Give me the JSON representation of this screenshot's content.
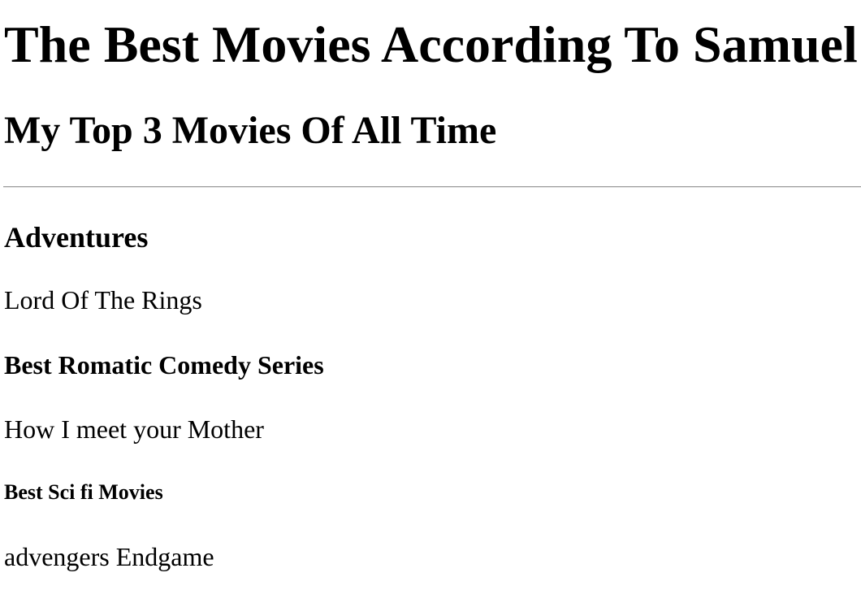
{
  "page": {
    "main_heading": "The Best Movies According To Samuel",
    "sub_heading": "My Top 3 Movies Of All Time"
  },
  "sections": [
    {
      "heading": "Adventures",
      "movie": "Lord Of The Rings"
    },
    {
      "heading": "Best Romatic Comedy Series",
      "movie": "How I meet your Mother"
    },
    {
      "heading": "Best Sci fi Movies",
      "movie": "advengers Endgame"
    }
  ]
}
